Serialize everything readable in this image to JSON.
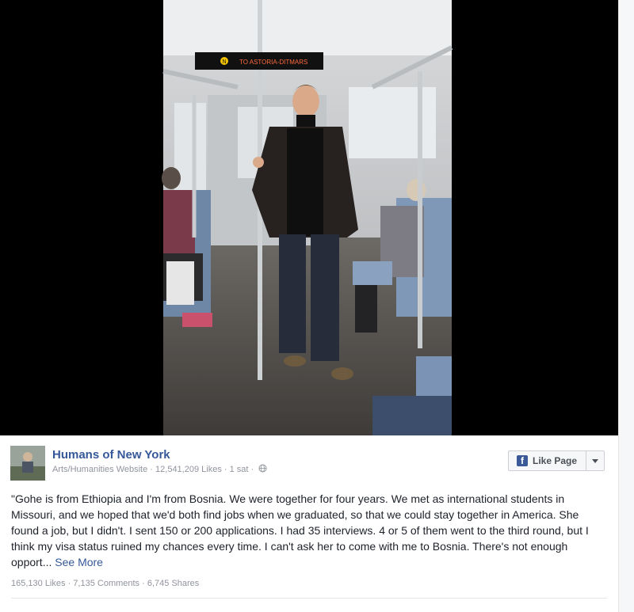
{
  "post": {
    "page_name": "Humans of New York",
    "category": "Arts/Humanities Website",
    "page_likes": "12,541,209 Likes",
    "time": "1 sat",
    "text": "\"Gohe is from Ethiopia and I'm from Bosnia. We were together for four years. We met as international students in Missouri, and we hoped that we'd both find jobs when we graduated, so that we could stay together in America. She found a job, but I didn't. I sent 150 or 200 applications. I had 35 interviews. 4 or 5 of them went to the third round, but I think my visa status ruined my chances every time. I can't ask her to come with me to Bosnia. There's not enough opport...",
    "see_more": "See More",
    "likes": "165,130 Likes",
    "comments": "7,135 Comments",
    "shares": "6,745 Shares"
  },
  "like_button": {
    "label": "Like Page",
    "icon": "facebook-f-icon"
  },
  "photo": {
    "sign_text": "TO ASTORIA-DITMARS",
    "sign_badge": "N"
  },
  "colors": {
    "link": "#365899",
    "meta": "#90949c",
    "text": "#1d2129",
    "brand": "#3b5998"
  }
}
